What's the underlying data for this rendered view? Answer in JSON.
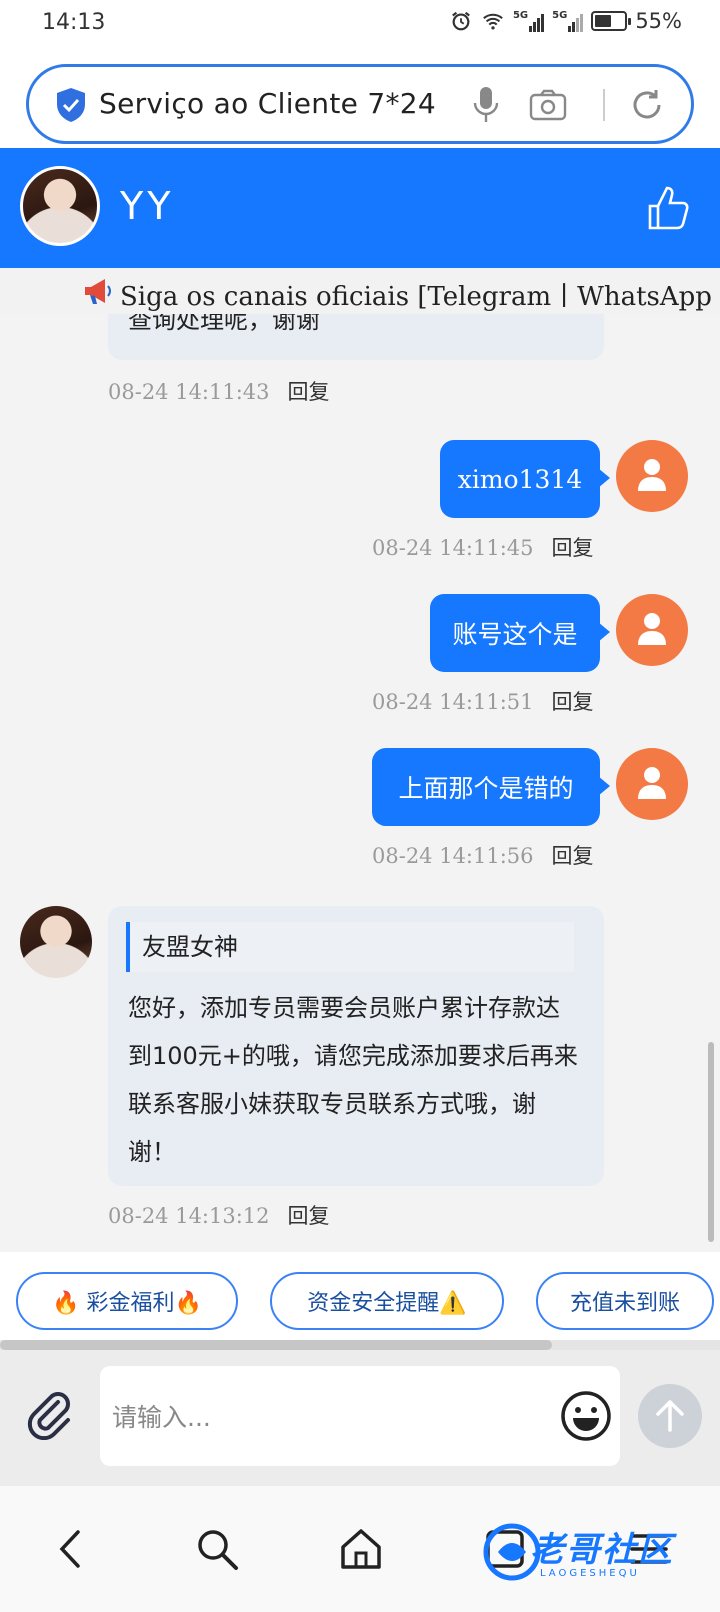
{
  "status_bar": {
    "time": "14:13",
    "battery": "55%",
    "battery_level": 0.55,
    "network_1": "5G",
    "network_2": "5G"
  },
  "url_bar": {
    "text": "Serviço ao Cliente 7*24"
  },
  "header": {
    "name": "YY"
  },
  "notice": {
    "text": "Siga os canais oficiais [Telegram丨WhatsApp丨In"
  },
  "messages": [
    {
      "side": "agent",
      "text": "查询处理呢，谢谢",
      "time": "08-24 14:11:43",
      "reply": "回复"
    },
    {
      "side": "user",
      "text": "ximo1314",
      "time": "08-24 14:11:45",
      "reply": "回复"
    },
    {
      "side": "user",
      "text": "账号这个是",
      "time": "08-24 14:11:51",
      "reply": "回复"
    },
    {
      "side": "user",
      "text": "上面那个是错的",
      "time": "08-24 14:11:56",
      "reply": "回复"
    },
    {
      "side": "agent",
      "quote": "友盟女神",
      "text": "您好，添加专员需要会员账户累计存款达到100元+的哦，请您完成添加要求后再来联系客服小妹获取专员联系方式哦，谢谢！",
      "time": "08-24 14:13:12",
      "reply": "回复"
    }
  ],
  "quick_replies": [
    "🔥 彩金福利🔥",
    "资金安全提醒⚠️",
    "充值未到账"
  ],
  "input": {
    "placeholder": "请输入..."
  },
  "watermark": {
    "text": "老哥社区",
    "sub": "LAOGESHEQU"
  },
  "colors": {
    "brand": "#1677ff",
    "user_avatar": "#f47a45",
    "agent_bubble": "#e8ecf3"
  }
}
